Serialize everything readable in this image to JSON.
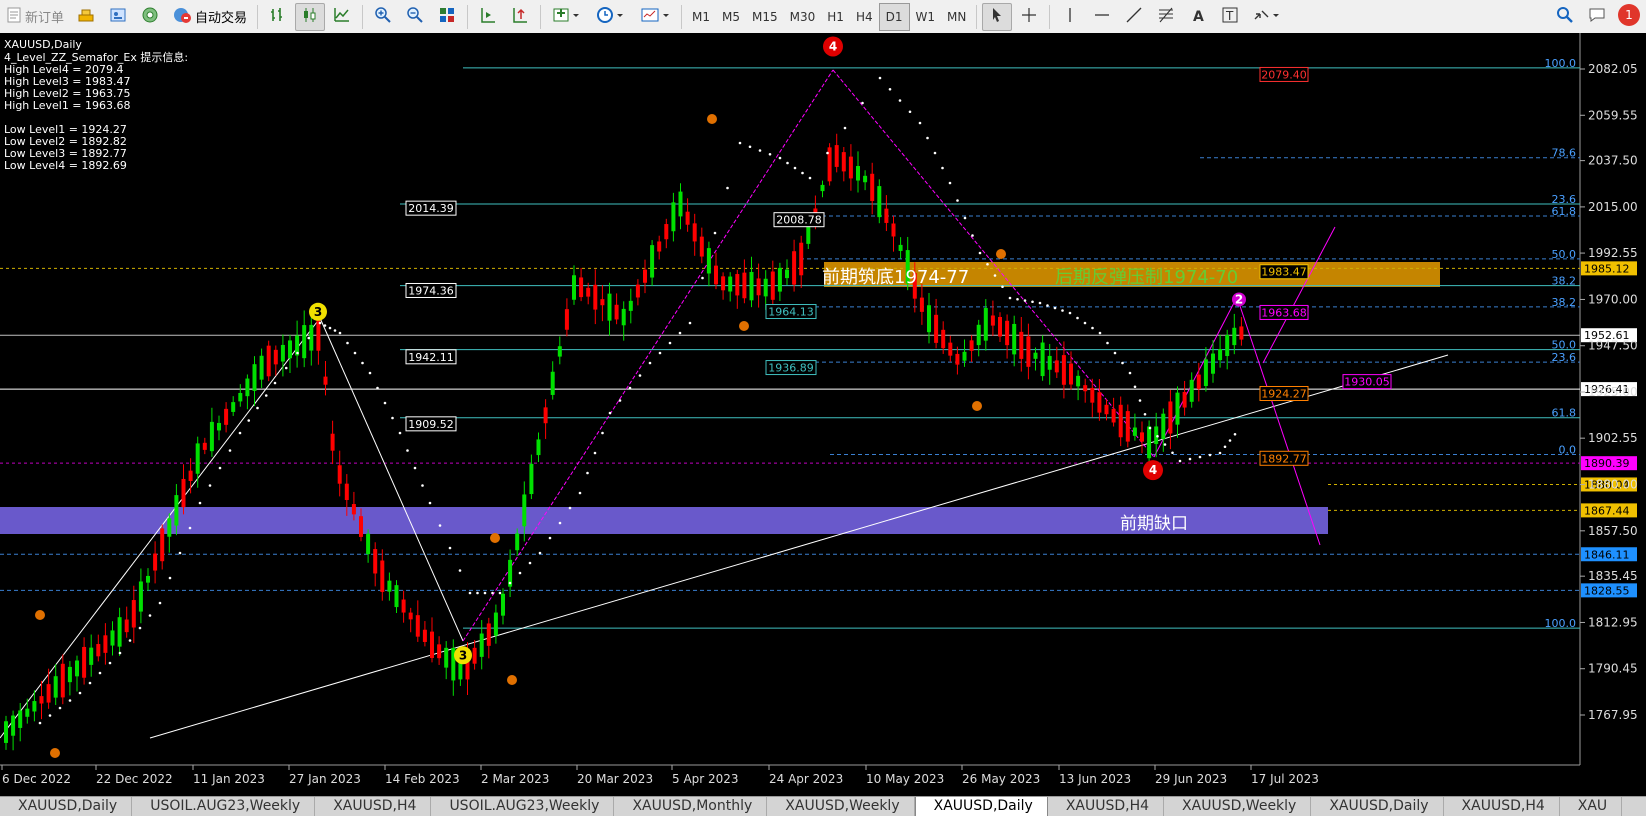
{
  "toolbar": {
    "new_order": "新订单",
    "auto_trade": "自动交易",
    "timeframes": [
      "M1",
      "M5",
      "M15",
      "M30",
      "H1",
      "H4",
      "D1",
      "W1",
      "MN"
    ],
    "active_timeframe": "D1",
    "notification_count": "1"
  },
  "info": {
    "symbol": "XAUUSD,Daily",
    "indicator": "4_Level_ZZ_Semafor_Ex 提示信息:",
    "high_lines": [
      "High Level4 = 2079.4",
      "High Level3 = 1983.47",
      "High Level2 = 1963.75",
      "High Level1 = 1963.68"
    ],
    "low_lines": [
      "Low Level1 = 1924.27",
      "Low Level2 = 1892.82",
      "Low Level3 = 1892.77",
      "Low Level4 = 1892.69"
    ]
  },
  "chart": {
    "price_axis": [
      "2082.05",
      "2059.55",
      "2037.50",
      "2015.00",
      "1992.55",
      "1970.00",
      "1947.50",
      "1925.00",
      "1902.55",
      "1880.00",
      "1857.50",
      "1835.45",
      "1812.95",
      "1790.45",
      "1767.95"
    ],
    "date_axis": [
      "6 Dec 2022",
      "22 Dec 2022",
      "11 Jan 2023",
      "27 Jan 2023",
      "14 Feb 2023",
      "2 Mar 2023",
      "20 Mar 2023",
      "5 Apr 2023",
      "24 Apr 2023",
      "10 May 2023",
      "26 May 2023",
      "13 Jun 2023",
      "29 Jun 2023",
      "17 Jul 2023"
    ],
    "price_tags": [
      {
        "text": "1985.12",
        "price": 1985.12,
        "bg": "#f0c000",
        "fg": "#000000"
      },
      {
        "text": "1952.61",
        "price": 1952.61,
        "bg": "#ffffff",
        "fg": "#000000"
      },
      {
        "text": "1926.41",
        "price": 1926.41,
        "bg": "#ffffff",
        "fg": "#000000"
      },
      {
        "text": "1890.39",
        "price": 1890.39,
        "bg": "#ff00ff",
        "fg": "#000000"
      },
      {
        "text": "1880.04",
        "price": 1880.04,
        "bg": "#f0c000",
        "fg": "#000000"
      },
      {
        "text": "1867.44",
        "price": 1867.44,
        "bg": "#f0c000",
        "fg": "#000000"
      },
      {
        "text": "1846.11",
        "price": 1846.11,
        "bg": "#1e90ff",
        "fg": "#000000"
      },
      {
        "text": "1828.55",
        "price": 1828.55,
        "bg": "#1e90ff",
        "fg": "#000000"
      }
    ],
    "left_level_labels": [
      {
        "text": "2014.39",
        "price": 2014.39
      },
      {
        "text": "1974.36",
        "price": 1974.36
      },
      {
        "text": "1942.11",
        "price": 1942.11
      },
      {
        "text": "1909.52",
        "price": 1909.52
      }
    ],
    "mid_level_labels": [
      {
        "text": "2008.78",
        "price": 2008.78
      },
      {
        "text": "1964.13",
        "price": 1964.13
      },
      {
        "text": "1936.89",
        "price": 1936.89
      }
    ],
    "fib_labels": [
      {
        "text": "100.0",
        "price": 2082.6
      },
      {
        "text": "78.6",
        "price": 2038.9
      },
      {
        "text": "23.6",
        "price": 2016.4
      },
      {
        "text": "61.8",
        "price": 2010.6
      },
      {
        "text": "50.0",
        "price": 1989.7
      },
      {
        "text": "38.2",
        "price": 1976.7
      },
      {
        "text": "38.2",
        "price": 1966.4
      },
      {
        "text": "50.0",
        "price": 1945.6
      },
      {
        "text": "23.6",
        "price": 1939.5
      },
      {
        "text": "61.8",
        "price": 1912.5
      },
      {
        "text": "0.0",
        "price": 1894.6
      },
      {
        "text": "100.0",
        "price": 1810.2
      }
    ],
    "right_level_labels": [
      {
        "text": "2079.40",
        "price": 2079.4
      },
      {
        "text": "1983.47",
        "price": 1983.47
      },
      {
        "text": "1963.68",
        "price": 1963.68
      },
      {
        "text": "1930.05",
        "price": 1930.05
      },
      {
        "text": "1924.27",
        "price": 1924.27
      },
      {
        "text": "1892.77",
        "price": 1892.77
      }
    ],
    "annotations": {
      "support_label": "前期筑底1974-77",
      "resistance_label": "后期反弹压制1974-70",
      "gap_label": "前期缺口"
    },
    "semafor_marks": [
      {
        "text": "4",
        "date": "24 Apr 2023",
        "price": 2093
      },
      {
        "text": "3",
        "date": "27 Jan 2023",
        "price": 1964
      },
      {
        "text": "3",
        "date": "14 Feb 2023",
        "price": 1797
      },
      {
        "text": "4",
        "date": "29 Jun 2023",
        "price": 1887
      },
      {
        "text": "2",
        "date": "17 Jul 2023",
        "price": 1970
      }
    ]
  }
}
